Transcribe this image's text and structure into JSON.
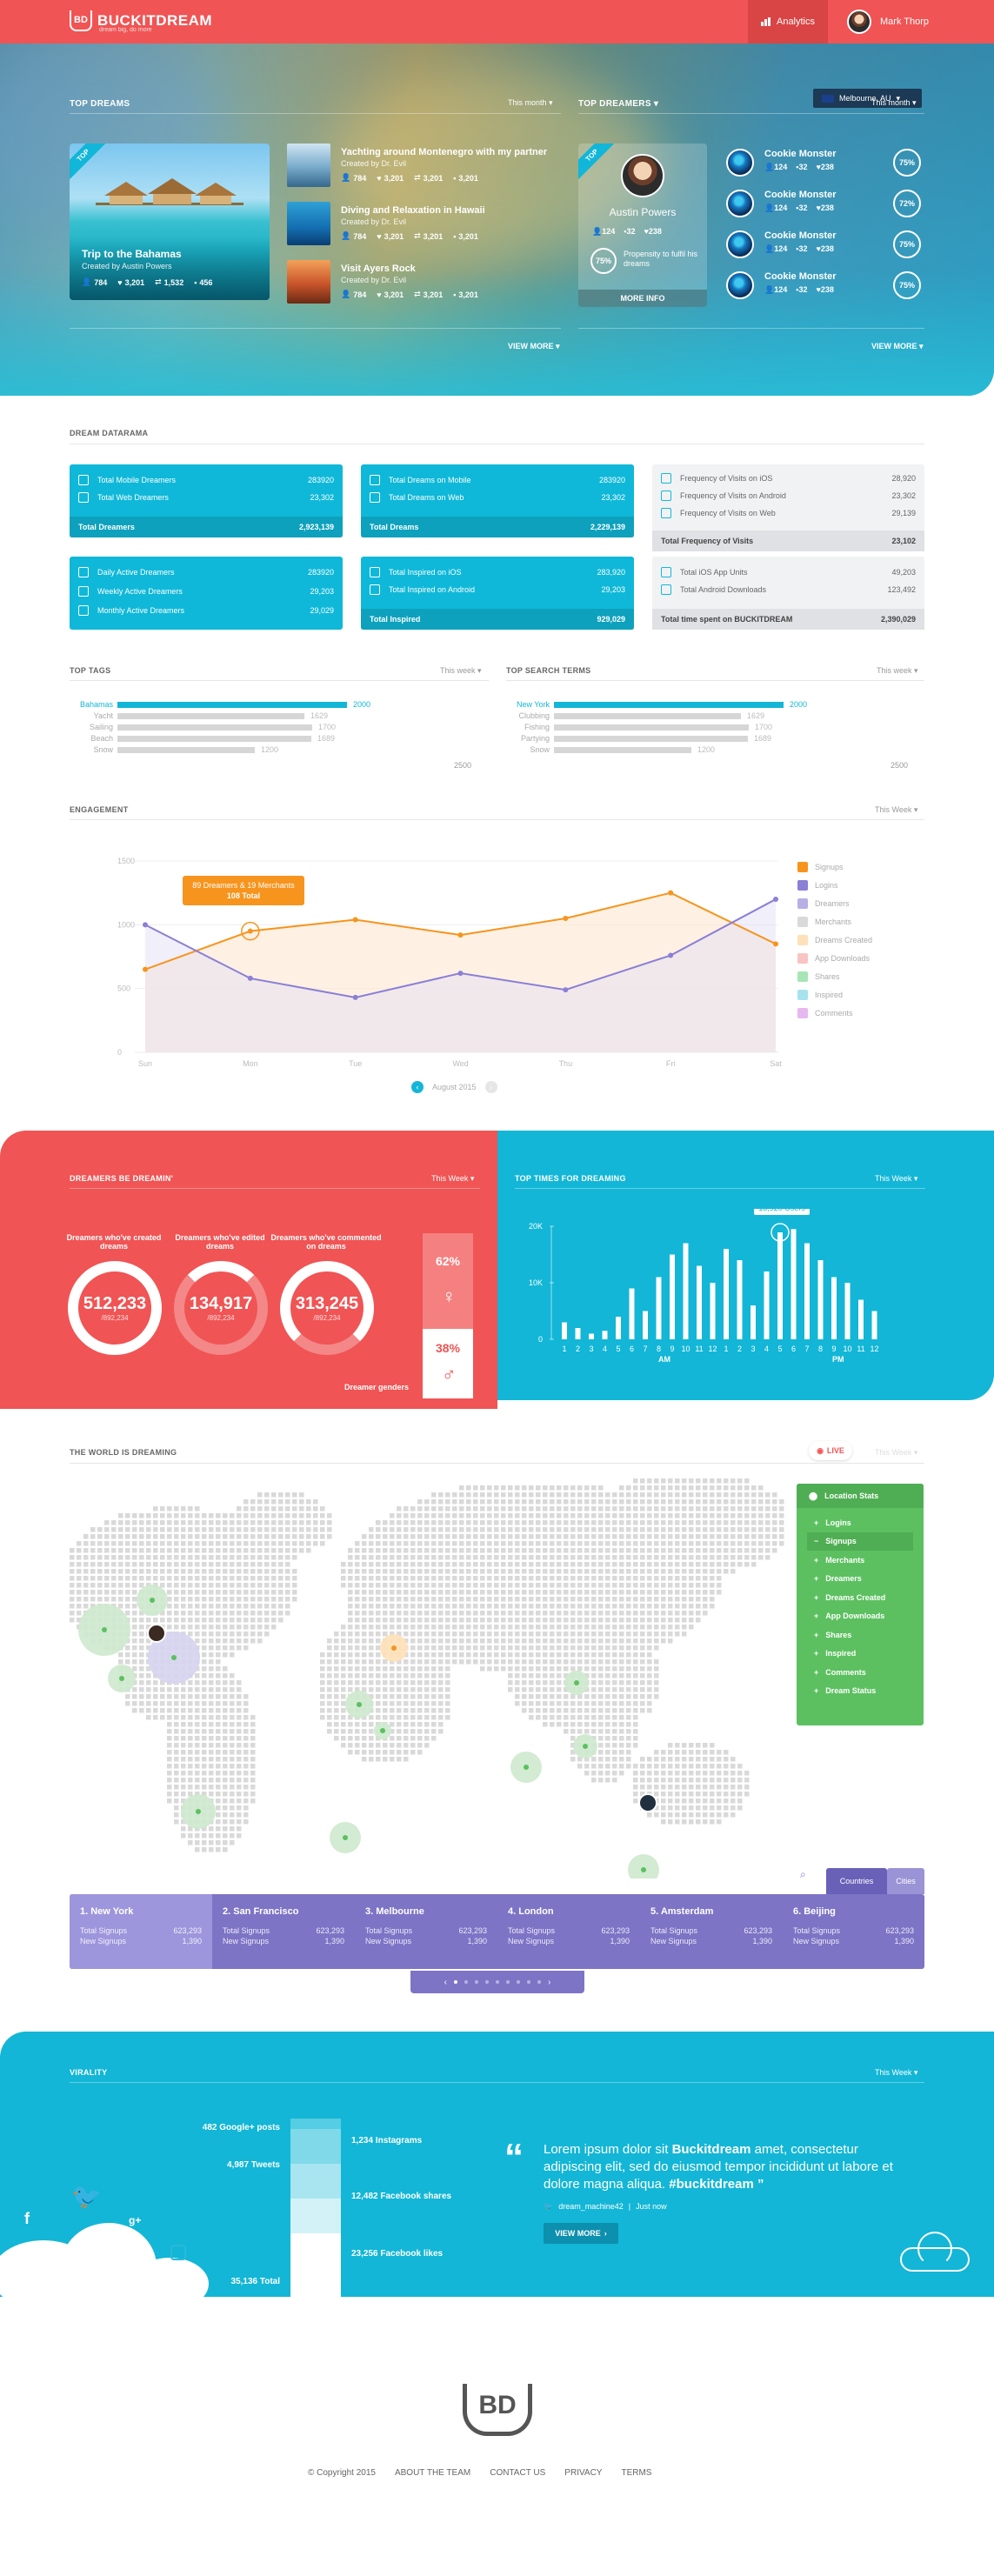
{
  "header": {
    "brand": "BUCKITDREAM",
    "tagline": "dream big, do more",
    "logo_mark": "BD",
    "analytics": "Analytics",
    "user": "Mark Thorp",
    "location": "Melbourne, AU"
  },
  "hero": {
    "top_dreams": {
      "title": "TOP DREAMS",
      "period": "This month",
      "view_more": "VIEW MORE",
      "featured": {
        "badge": "TOP",
        "title": "Trip to the Bahamas",
        "by": "Created by Austin Powers",
        "stats": [
          "784",
          "3,201",
          "1,532",
          "456"
        ]
      },
      "list": [
        {
          "title": "Yachting around Montenegro with my partner",
          "by": "Created by Dr. Evil",
          "stats": [
            "784",
            "3,201",
            "3,201",
            "3,201"
          ]
        },
        {
          "title": "Diving and Relaxation in Hawaii",
          "by": "Created by Dr. Evil",
          "stats": [
            "784",
            "3,201",
            "3,201",
            "3,201"
          ]
        },
        {
          "title": "Visit Ayers Rock",
          "by": "Created by Dr. Evil",
          "stats": [
            "784",
            "3,201",
            "3,201",
            "3,201"
          ]
        }
      ]
    },
    "top_dreamers": {
      "title": "TOP DREAMERS",
      "period": "This month",
      "view_more": "VIEW MORE",
      "featured": {
        "badge": "TOP",
        "name": "Austin Powers",
        "stats": [
          "124",
          "32",
          "238"
        ],
        "ring": "75%",
        "desc": "Propensity to fulfil his dreams",
        "more": "MORE INFO"
      },
      "list": [
        {
          "name": "Cookie Monster",
          "stats": [
            "124",
            "32",
            "238"
          ],
          "ring": "75%"
        },
        {
          "name": "Cookie Monster",
          "stats": [
            "124",
            "32",
            "238"
          ],
          "ring": "72%"
        },
        {
          "name": "Cookie Monster",
          "stats": [
            "124",
            "32",
            "238"
          ],
          "ring": "75%"
        },
        {
          "name": "Cookie Monster",
          "stats": [
            "124",
            "32",
            "238"
          ],
          "ring": "75%"
        }
      ]
    }
  },
  "datarama": {
    "title": "DREAM DATARAMA",
    "cards": [
      {
        "rows": [
          [
            "Total Mobile Dreamers",
            "283920"
          ],
          [
            "Total Web Dreamers",
            "23,302"
          ]
        ],
        "total": [
          "Total Dreamers",
          "2,923,139"
        ]
      },
      {
        "rows": [
          [
            "Total Dreams on Mobile",
            "283920"
          ],
          [
            "Total Dreams on Web",
            "23,302"
          ]
        ],
        "total": [
          "Total Dreams",
          "2,229,139"
        ]
      },
      {
        "rows": [
          [
            "Frequency of Visits on iOS",
            "28,920"
          ],
          [
            "Frequency of Visits on Android",
            "23,302"
          ],
          [
            "Frequency of Visits on Web",
            "29,139"
          ]
        ],
        "total": [
          "Total Frequency of Visits",
          "23,102"
        ]
      },
      {
        "rows": [
          [
            "Daily Active Dreamers",
            "283920"
          ],
          [
            "Weekly Active Dreamers",
            "29,203"
          ],
          [
            "Monthly Active Dreamers",
            "29,029"
          ]
        ]
      },
      {
        "rows": [
          [
            "Total Inspired on iOS",
            "283,920"
          ],
          [
            "Total Inspired on Android",
            "29,203"
          ]
        ],
        "total": [
          "Total Inspired",
          "929,029"
        ]
      },
      {
        "rows": [
          [
            "Total iOS App Units",
            "49,203"
          ],
          [
            "Total Android Downloads",
            "123,492"
          ]
        ],
        "total": [
          "Total time spent on BUCKITDREAM",
          "2,390,029"
        ]
      }
    ]
  },
  "tags": {
    "title": "TOP TAGS",
    "period": "This week",
    "max": "2500",
    "items": [
      [
        "Bahamas",
        "2000"
      ],
      [
        "Yacht",
        "1629"
      ],
      [
        "Sailing",
        "1700"
      ],
      [
        "Beach",
        "1689"
      ],
      [
        "Snow",
        "1200"
      ]
    ]
  },
  "terms": {
    "title": "TOP SEARCH TERMS",
    "period": "This week",
    "max": "2500",
    "items": [
      [
        "New York",
        "2000"
      ],
      [
        "Clubbing",
        "1629"
      ],
      [
        "Fishing",
        "1700"
      ],
      [
        "Partying",
        "1689"
      ],
      [
        "Snow",
        "1200"
      ]
    ]
  },
  "engagement": {
    "title": "ENGAGEMENT",
    "period": "This Week",
    "tooltip1": "89 Dreamers & 19 Merchants",
    "tooltip2": "108 Total",
    "month": "August 2015",
    "legend": [
      "Signups",
      "Logins",
      "Dreamers",
      "Merchants",
      "Dreams Created",
      "App Downloads",
      "Shares",
      "Inspired",
      "Comments"
    ]
  },
  "chart_data": [
    {
      "type": "line",
      "title": "",
      "categories": [
        "Sun",
        "Mon",
        "Tue",
        "Wed",
        "Thu",
        "Fri",
        "Sat"
      ],
      "ylim": [
        0,
        1500
      ],
      "yticks": [
        "0",
        "500",
        "1000",
        "1500"
      ],
      "series": [
        {
          "name": "Signups",
          "color": "#f7941d",
          "values": [
            650,
            950,
            1040,
            920,
            1050,
            1250,
            850
          ]
        },
        {
          "name": "Logins",
          "color": "#8b7fd6",
          "values": [
            1000,
            580,
            430,
            620,
            490,
            760,
            1200
          ]
        }
      ]
    },
    {
      "type": "bar",
      "title": "TOP TIMES FOR DREAMING",
      "categories": [
        "1",
        "2",
        "3",
        "4",
        "5",
        "6",
        "7",
        "8",
        "9",
        "10",
        "11",
        "12",
        "1",
        "2",
        "3",
        "4",
        "5",
        "6",
        "7",
        "8",
        "9",
        "10",
        "11",
        "12"
      ],
      "ylim": [
        0,
        20000
      ],
      "yticks": [
        "0",
        "10K",
        "20K"
      ],
      "annotation": "18,920 Users",
      "values": [
        3000,
        2000,
        1000,
        1500,
        4000,
        9000,
        5000,
        11000,
        15000,
        17000,
        13000,
        10000,
        16000,
        14000,
        6000,
        12000,
        18920,
        19500,
        17000,
        14000,
        11000,
        10000,
        7000,
        5000
      ]
    }
  ],
  "dreamin": {
    "title": "DREAMERS BE DREAMIN'",
    "period": "This Week",
    "donuts": [
      {
        "label": "Dreamers who've created dreams",
        "value": "512,233",
        "sub": "/892,234"
      },
      {
        "label": "Dreamers who've edited dreams",
        "value": "134,917",
        "sub": "/892,234"
      },
      {
        "label": "Dreamers who've commented on dreams",
        "value": "313,245",
        "sub": "/892,234"
      }
    ],
    "female": "62%",
    "male": "38%",
    "gender_label": "Dreamer genders"
  },
  "toptimes": {
    "title": "TOP TIMES FOR DREAMING",
    "period": "This Week",
    "am": "AM",
    "pm": "PM"
  },
  "world": {
    "title": "THE WORLD IS DREAMING",
    "live": "LIVE",
    "period": "This Week",
    "tab1": "Countries",
    "tab2": "Cities",
    "stats_title": "Location Stats",
    "stats": [
      "Logins",
      "Signups",
      "Merchants",
      "Dreamers",
      "Dreams Created",
      "App Downloads",
      "Shares",
      "Inspired",
      "Comments",
      "Dream Status"
    ],
    "cities": [
      {
        "name": "1. New York",
        "a": "623,293",
        "b": "1,390"
      },
      {
        "name": "2. San Francisco",
        "a": "623,293",
        "b": "1,390"
      },
      {
        "name": "3. Melbourne",
        "a": "623,293",
        "b": "1,390"
      },
      {
        "name": "4. London",
        "a": "623,293",
        "b": "1,390"
      },
      {
        "name": "5. Amsterdam",
        "a": "623,293",
        "b": "1,390"
      },
      {
        "name": "6. Beijing",
        "a": "623,293",
        "b": "1,390"
      }
    ],
    "signups": "Total Signups",
    "newsignups": "New Signups"
  },
  "virality": {
    "title": "VIRALITY",
    "period": "This Week",
    "google": "482 Google+ posts",
    "tweets": "4,987 Tweets",
    "instagram": "1,234 Instagrams",
    "fbshares": "12,482 Facebook shares",
    "fblikes": "23,256 Facebook likes",
    "total": "35,136 Total",
    "quote_a": "Lorem ipsum dolor sit ",
    "quote_b": "Buckitdream",
    "quote_c": " amet, consectetur adipiscing elit, sed do eiusmod tempor incididunt ut labore et dolore magna aliqua. ",
    "quote_d": "#buckitdream",
    "handle": "dream_machine42",
    "time": "Just now",
    "button": "VIEW MORE"
  },
  "footer": {
    "copyright": "© Copyright 2015",
    "links": [
      "ABOUT THE TEAM",
      "CONTACT US",
      "PRIVACY",
      "TERMS"
    ],
    "logo": "BD"
  }
}
